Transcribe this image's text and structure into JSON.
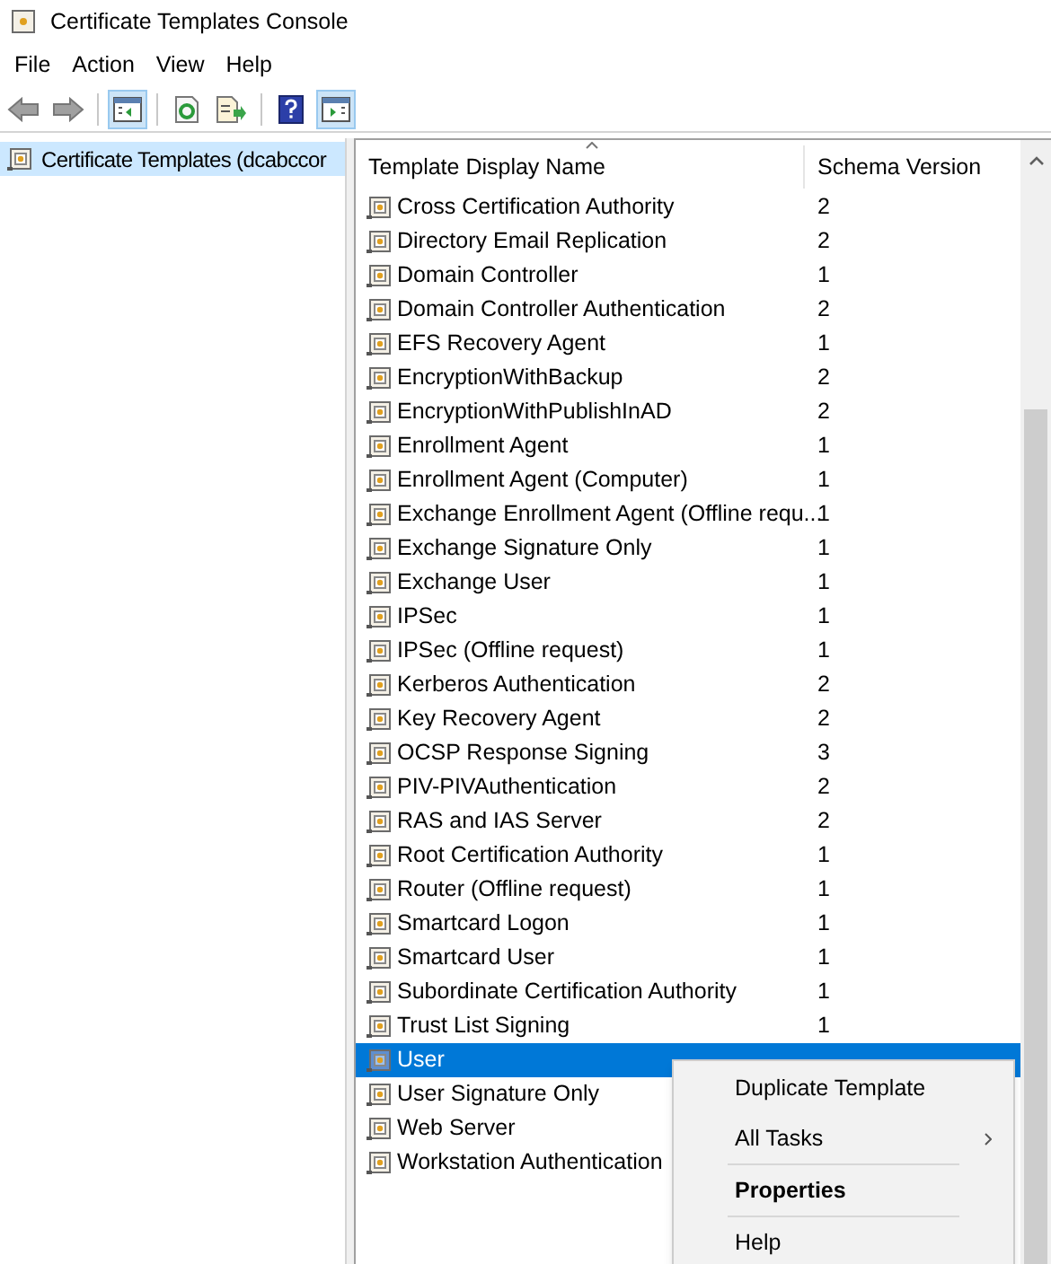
{
  "window": {
    "title": "Certificate Templates Console"
  },
  "menu": [
    "File",
    "Action",
    "View",
    "Help"
  ],
  "toolbar": [
    {
      "kind": "back",
      "on": false
    },
    {
      "kind": "forward",
      "on": false
    },
    {
      "kind": "sep"
    },
    {
      "kind": "tree",
      "on": true
    },
    {
      "kind": "sep"
    },
    {
      "kind": "refresh",
      "on": false
    },
    {
      "kind": "export",
      "on": false
    },
    {
      "kind": "sep"
    },
    {
      "kind": "help",
      "on": false
    },
    {
      "kind": "action",
      "on": true
    }
  ],
  "tree": {
    "label": "Certificate Templates (dcabccor",
    "selected": true
  },
  "table": {
    "columns": [
      "Template Display Name",
      "Schema Version"
    ],
    "rows": [
      {
        "name": "Cross Certification Authority",
        "version": "2",
        "selected": false
      },
      {
        "name": "Directory Email Replication",
        "version": "2",
        "selected": false
      },
      {
        "name": "Domain Controller",
        "version": "1",
        "selected": false
      },
      {
        "name": "Domain Controller Authentication",
        "version": "2",
        "selected": false
      },
      {
        "name": "EFS Recovery Agent",
        "version": "1",
        "selected": false
      },
      {
        "name": "EncryptionWithBackup",
        "version": "2",
        "selected": false
      },
      {
        "name": "EncryptionWithPublishInAD",
        "version": "2",
        "selected": false
      },
      {
        "name": "Enrollment Agent",
        "version": "1",
        "selected": false
      },
      {
        "name": "Enrollment Agent (Computer)",
        "version": "1",
        "selected": false
      },
      {
        "name": "Exchange Enrollment Agent (Offline requ...",
        "version": "1",
        "selected": false
      },
      {
        "name": "Exchange Signature Only",
        "version": "1",
        "selected": false
      },
      {
        "name": "Exchange User",
        "version": "1",
        "selected": false
      },
      {
        "name": "IPSec",
        "version": "1",
        "selected": false
      },
      {
        "name": "IPSec (Offline request)",
        "version": "1",
        "selected": false
      },
      {
        "name": "Kerberos Authentication",
        "version": "2",
        "selected": false
      },
      {
        "name": "Key Recovery Agent",
        "version": "2",
        "selected": false
      },
      {
        "name": "OCSP Response Signing",
        "version": "3",
        "selected": false
      },
      {
        "name": "PIV-PIVAuthentication",
        "version": "2",
        "selected": false
      },
      {
        "name": "RAS and IAS Server",
        "version": "2",
        "selected": false
      },
      {
        "name": "Root Certification Authority",
        "version": "1",
        "selected": false
      },
      {
        "name": "Router (Offline request)",
        "version": "1",
        "selected": false
      },
      {
        "name": "Smartcard Logon",
        "version": "1",
        "selected": false
      },
      {
        "name": "Smartcard User",
        "version": "1",
        "selected": false
      },
      {
        "name": "Subordinate Certification Authority",
        "version": "1",
        "selected": false
      },
      {
        "name": "Trust List Signing",
        "version": "1",
        "selected": false
      },
      {
        "name": "User",
        "selected": true
      },
      {
        "name": "User Signature Only",
        "selected": false
      },
      {
        "name": "Web Server",
        "selected": false
      },
      {
        "name": "Workstation Authentication",
        "selected": false
      }
    ]
  },
  "context_menu": [
    {
      "label": "Duplicate Template",
      "kind": "item"
    },
    {
      "label": "All Tasks",
      "kind": "submenu"
    },
    {
      "kind": "separator"
    },
    {
      "label": "Properties",
      "kind": "default"
    },
    {
      "kind": "separator"
    },
    {
      "label": "Help",
      "kind": "item"
    }
  ]
}
